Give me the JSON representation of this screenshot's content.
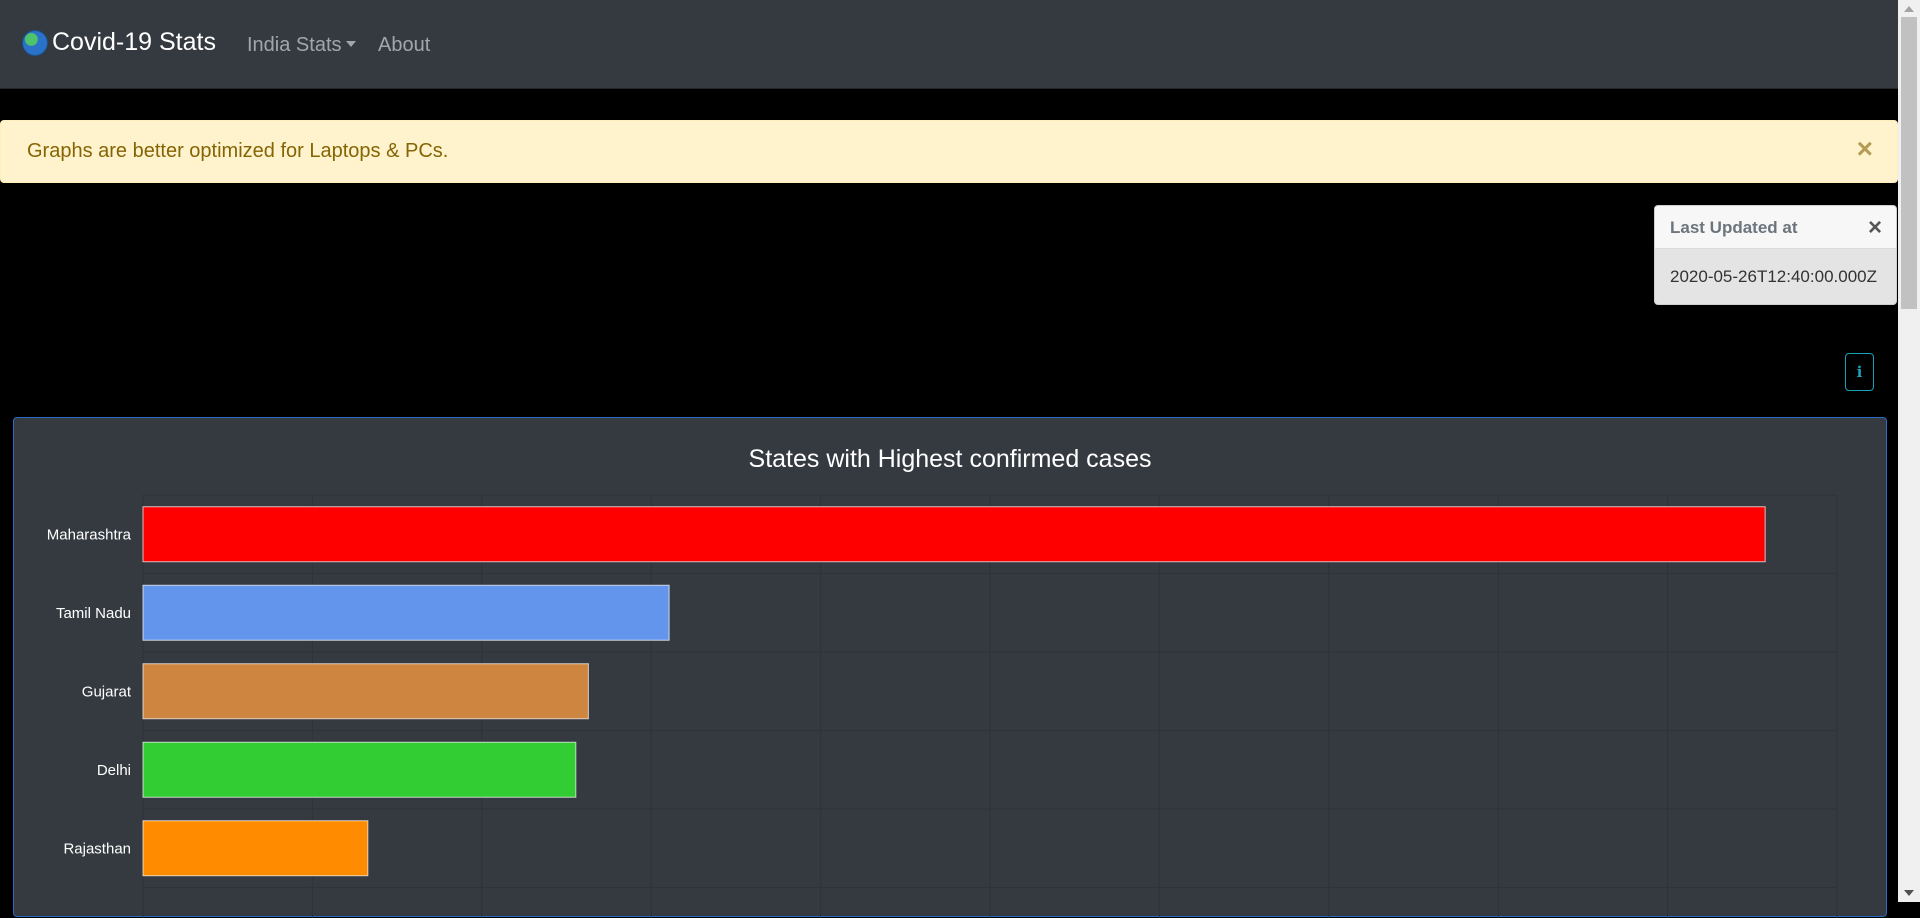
{
  "navbar": {
    "brand": "Covid-19 Stats",
    "brand_icon": "globe-icon",
    "india_stats": "India Stats",
    "about": "About"
  },
  "alert": {
    "message": "Graphs are better optimized for Laptops & PCs.",
    "close": "×"
  },
  "toast": {
    "title": "Last Updated at",
    "close": "×",
    "body": "2020-05-26T12:40:00.000Z"
  },
  "info_button": "i",
  "chart_data": {
    "type": "bar",
    "orientation": "horizontal",
    "title": "States with Highest confirmed cases",
    "categories": [
      "Maharashtra",
      "Tamil Nadu",
      "Gujarat",
      "Delhi",
      "Rajasthan"
    ],
    "values": [
      52667,
      17082,
      14460,
      14053,
      7300
    ],
    "colors": [
      "#ff0000",
      "#6495ed",
      "#cd853f",
      "#32cd32",
      "#ff8c00"
    ],
    "xlim": [
      0,
      55000
    ],
    "grid": true
  }
}
